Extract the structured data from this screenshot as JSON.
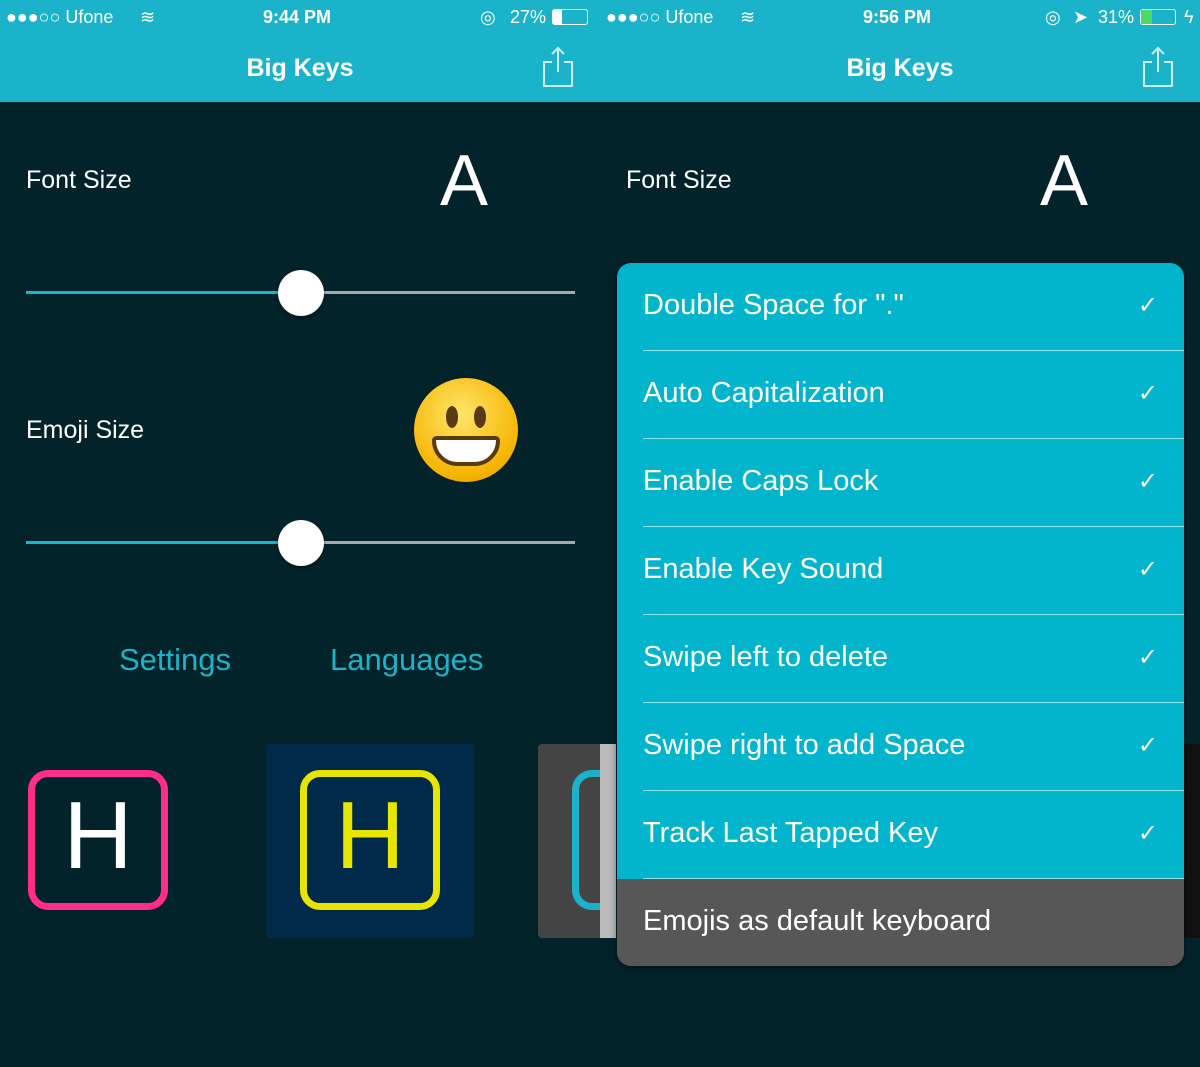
{
  "left": {
    "status": {
      "carrier": "●●●○○ Ufone",
      "time": "9:44 PM",
      "battery": "27%",
      "battery_level": 0.27
    },
    "nav": {
      "title": "Big Keys",
      "share_icon": "share-icon"
    },
    "font_size": {
      "label": "Font Size",
      "preview": "A",
      "value": 0.5
    },
    "emoji_size": {
      "label": "Emoji Size",
      "preview_icon": "grinning-face-emoji",
      "value": 0.5
    },
    "links": {
      "settings": "Settings",
      "languages": "Languages"
    },
    "themes": [
      {
        "letter": "H",
        "border": "#ff2d8a",
        "bg": "#03232a",
        "color": "#ffffff"
      },
      {
        "letter": "H",
        "border": "#e6e600",
        "bg": "#01294a",
        "color": "#e6e600"
      }
    ]
  },
  "right": {
    "status": {
      "carrier": "●●●○○ Ufone",
      "time": "9:56 PM",
      "battery": "31%",
      "battery_level": 0.31,
      "charging": true
    },
    "nav": {
      "title": "Big Keys"
    },
    "font_size": {
      "label": "Font Size",
      "preview": "A"
    },
    "menu": [
      {
        "label": "Double Space for \".\"",
        "checked": true
      },
      {
        "label": "Auto Capitalization",
        "checked": true
      },
      {
        "label": "Enable Caps Lock",
        "checked": true
      },
      {
        "label": "Enable Key Sound",
        "checked": true
      },
      {
        "label": "Swipe left to delete",
        "checked": true
      },
      {
        "label": "Swipe right to add Space",
        "checked": true
      },
      {
        "label": "Track Last Tapped Key",
        "checked": true
      },
      {
        "label": "Emojis as default keyboard",
        "checked": false
      }
    ],
    "check": "✓"
  },
  "colors": {
    "accent": "#1bb3c9",
    "background": "#03232a",
    "menu": "#02b5cc",
    "menu_inactive": "#575757"
  }
}
